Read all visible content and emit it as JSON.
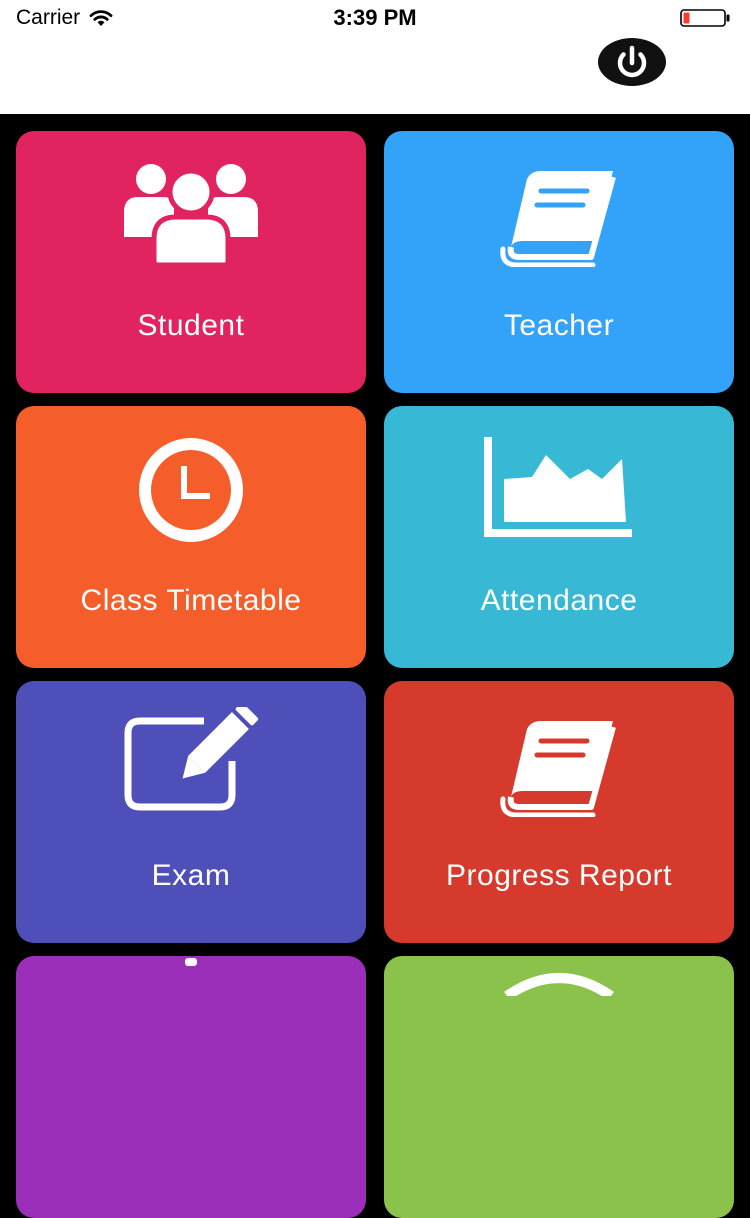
{
  "status_bar": {
    "carrier": "Carrier",
    "time": "3:39 PM",
    "battery_color": "#ff3b30"
  },
  "header": {
    "power_icon": "power-icon"
  },
  "tiles": [
    {
      "label": "Student",
      "color": "#e1235f",
      "icon": "users-icon"
    },
    {
      "label": "Teacher",
      "color": "#33a2f9",
      "icon": "book-icon"
    },
    {
      "label": "Class Timetable",
      "color": "#f55e2a",
      "icon": "clock-icon"
    },
    {
      "label": "Attendance",
      "color": "#37b9d6",
      "icon": "area-chart-icon"
    },
    {
      "label": "Exam",
      "color": "#4e4fb9",
      "icon": "edit-icon"
    },
    {
      "label": "Progress Report",
      "color": "#d53a2d",
      "icon": "book-icon"
    },
    {
      "label": "",
      "color": "#9b2fb9",
      "icon": ""
    },
    {
      "label": "",
      "color": "#8bc24b",
      "icon": ""
    }
  ]
}
